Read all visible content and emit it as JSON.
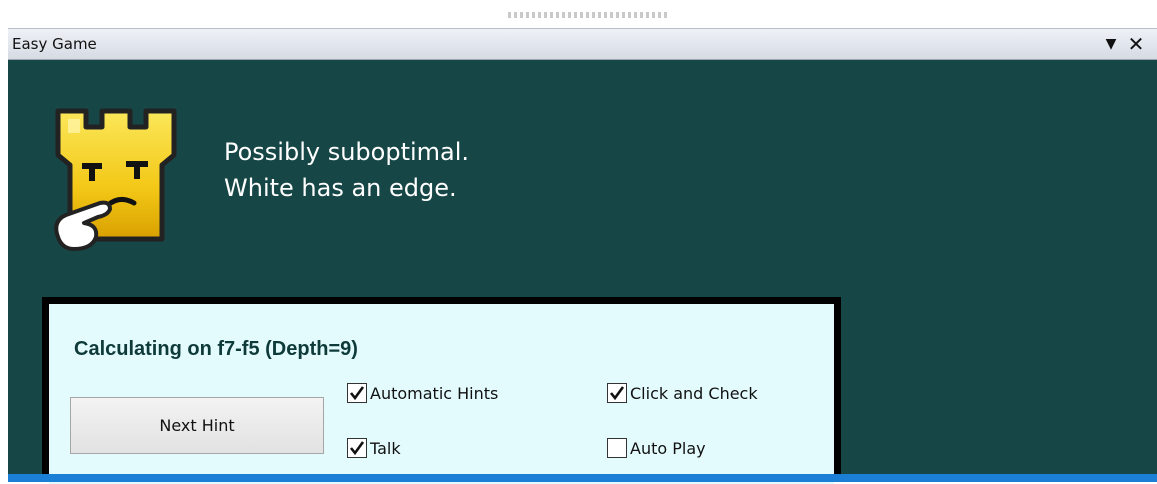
{
  "window": {
    "title": "Easy Game",
    "dropdown_icon": "triangle-down-icon",
    "close_icon": "close-icon"
  },
  "feedback": {
    "mascot_icon": "thinking-rook-icon",
    "line1": "Possibly suboptimal.",
    "line2": "White has an edge."
  },
  "controls": {
    "calc_status": "Calculating on f7-f5 (Depth=9)",
    "next_hint_label": "Next Hint",
    "checkboxes": [
      {
        "label": "Automatic Hints",
        "checked": true
      },
      {
        "label": "Click and Check",
        "checked": true
      },
      {
        "label": "Talk",
        "checked": true
      },
      {
        "label": "Auto Play",
        "checked": false
      }
    ]
  },
  "colors": {
    "panel_bg": "#174646",
    "card_bg": "#e3fbfd",
    "accent_bar": "#1c7fd6",
    "mascot_yellow": "#f5d21a"
  }
}
